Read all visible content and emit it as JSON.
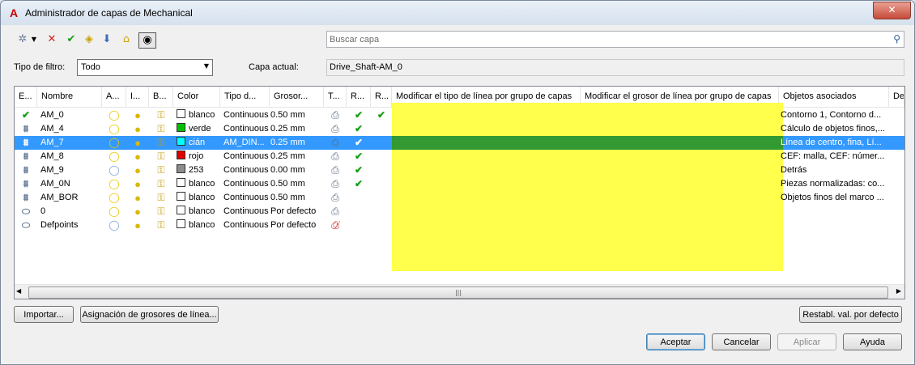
{
  "window": {
    "title": "Administrador de capas de Mechanical",
    "app_icon": "A",
    "close": "✕"
  },
  "toolbar": {
    "icons": [
      "new-layer-icon",
      "dropdown-arrow-icon",
      "delete-layer-icon",
      "set-current-icon",
      "layer-states-icon",
      "merge-layers-icon",
      "layer-lock-icon",
      "layer-visibility-toggle-icon"
    ]
  },
  "search": {
    "placeholder": "Buscar capa",
    "value": ""
  },
  "filter": {
    "label": "Tipo de filtro:",
    "value": "Todo"
  },
  "current_layer": {
    "label": "Capa actual:",
    "value": "Drive_Shaft-AM_0"
  },
  "grid": {
    "columns": [
      "E...",
      "Nombre",
      "A...",
      "I...",
      "B...",
      "Color",
      "Tipo d...",
      "Grosor...",
      "T...",
      "R...",
      "R...",
      "Modificar el tipo de línea por grupo de capas",
      "Modificar el grosor de línea por grupo de capas",
      "Objetos asociados",
      "De"
    ],
    "rows": [
      {
        "status": "current",
        "name": "AM_0",
        "color": "blanco",
        "hex": "#ffffff",
        "linetype": "Continuous",
        "lineweight": "0.50 mm",
        "r1": true,
        "r2": true,
        "objects": "Contorno 1, Contorno d...",
        "selected": false,
        "lightbulb": "on"
      },
      {
        "status": "layer",
        "name": "AM_4",
        "color": "verde",
        "hex": "#00c000",
        "linetype": "Continuous",
        "lineweight": "0.25 mm",
        "r1": true,
        "r2": false,
        "objects": "Cálculo de objetos finos,...",
        "selected": false,
        "lightbulb": "on"
      },
      {
        "status": "layer",
        "name": "AM_7",
        "color": "cián",
        "hex": "#00ffff",
        "linetype": "AM_DIN...",
        "lineweight": "0.25 mm",
        "r1": true,
        "r2": false,
        "objects": "Línea de centro, fina, Lí...",
        "selected": true,
        "lightbulb": "on"
      },
      {
        "status": "layer",
        "name": "AM_8",
        "color": "rojo",
        "hex": "#e00000",
        "linetype": "Continuous",
        "lineweight": "0.25 mm",
        "r1": true,
        "r2": false,
        "objects": "CEF: malla, CEF: númer...",
        "selected": false,
        "lightbulb": "on"
      },
      {
        "status": "layer",
        "name": "AM_9",
        "color": "253",
        "hex": "#8c8c8c",
        "linetype": "Continuous",
        "lineweight": "0.00 mm",
        "r1": true,
        "r2": false,
        "objects": "Detrás",
        "selected": false,
        "lightbulb": "off"
      },
      {
        "status": "layer",
        "name": "AM_0N",
        "color": "blanco",
        "hex": "#ffffff",
        "linetype": "Continuous",
        "lineweight": "0.50 mm",
        "r1": true,
        "r2": false,
        "objects": "Piezas normalizadas: co...",
        "selected": false,
        "lightbulb": "on"
      },
      {
        "status": "layer",
        "name": "AM_BOR",
        "color": "blanco",
        "hex": "#ffffff",
        "linetype": "Continuous",
        "lineweight": "0.50 mm",
        "r1": false,
        "r2": false,
        "objects": "Objetos finos del marco ...",
        "selected": false,
        "lightbulb": "on"
      },
      {
        "status": "plain",
        "name": "0",
        "color": "blanco",
        "hex": "#ffffff",
        "linetype": "Continuous",
        "lineweight": "Por defecto",
        "r1": false,
        "r2": false,
        "objects": "",
        "selected": false,
        "lightbulb": "on"
      },
      {
        "status": "plain",
        "name": "Defpoints",
        "color": "blanco",
        "hex": "#ffffff",
        "linetype": "Continuous",
        "lineweight": "Por defecto",
        "r1": false,
        "r2": false,
        "objects": "",
        "selected": false,
        "lightbulb": "off",
        "noplot": true
      }
    ]
  },
  "buttons": {
    "import": "Importar...",
    "lineweight_assign": "Asignación de grosores de línea...",
    "reset": "Restabl. val. por defecto",
    "accept": "Aceptar",
    "cancel": "Cancelar",
    "apply": "Aplicar",
    "help": "Ayuda"
  },
  "colors": {
    "selection": "#3399ff",
    "highlight": "#ffff33",
    "highlight_selected": "#339933",
    "check": "#14a014"
  }
}
